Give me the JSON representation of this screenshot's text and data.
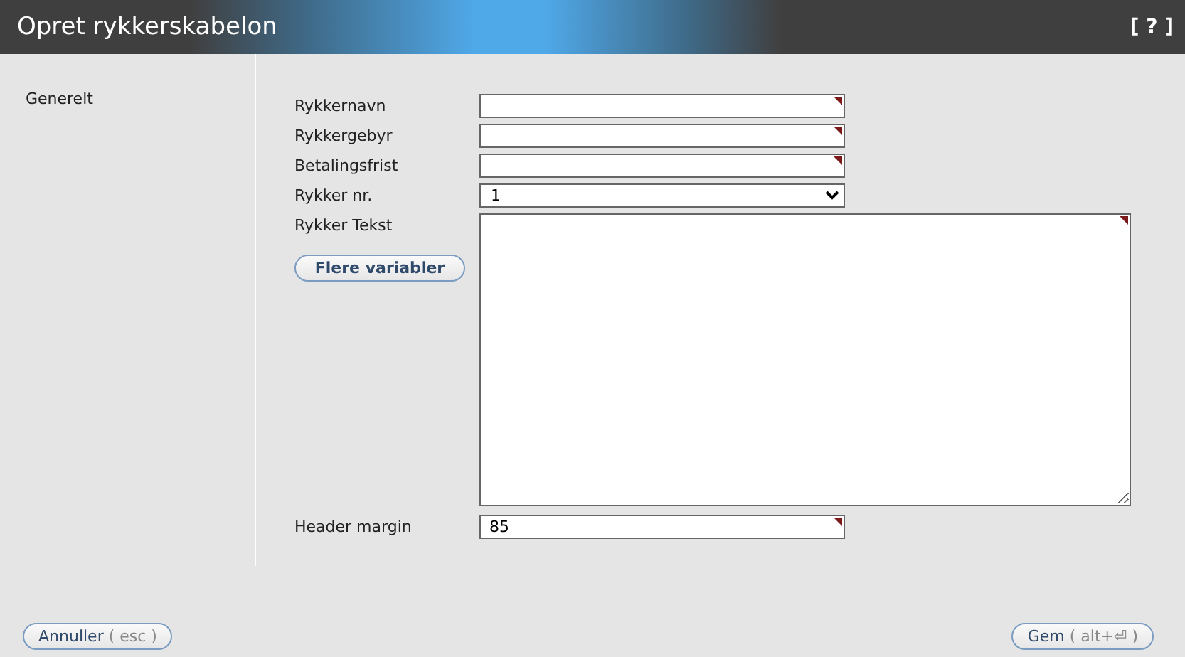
{
  "window": {
    "title": "Opret rykkerskabelon",
    "help": "[ ? ]"
  },
  "sidebar": {
    "items": [
      {
        "label": "Generelt",
        "selected": true
      }
    ]
  },
  "fields": [
    {
      "label": "Rykkernavn",
      "kind": "text",
      "required": true
    },
    {
      "label": "Rykkergebyr",
      "kind": "text",
      "required": true
    },
    {
      "label": "Betalingsfrist",
      "kind": "text",
      "required": true
    },
    {
      "label": "Rykker nr.",
      "kind": "select",
      "value": "1",
      "required": false
    },
    {
      "label": "Rykker Tekst",
      "kind": "textarea",
      "required": true,
      "button": "Flere variabler"
    },
    {
      "label": "Header margin",
      "kind": "text",
      "value": "85",
      "required": true
    }
  ],
  "footer": {
    "cancel": {
      "label": "Annuller",
      "shortcut": "( esc )"
    },
    "save": {
      "label": "Gem",
      "shortcut": "( alt+⏎ )"
    }
  }
}
